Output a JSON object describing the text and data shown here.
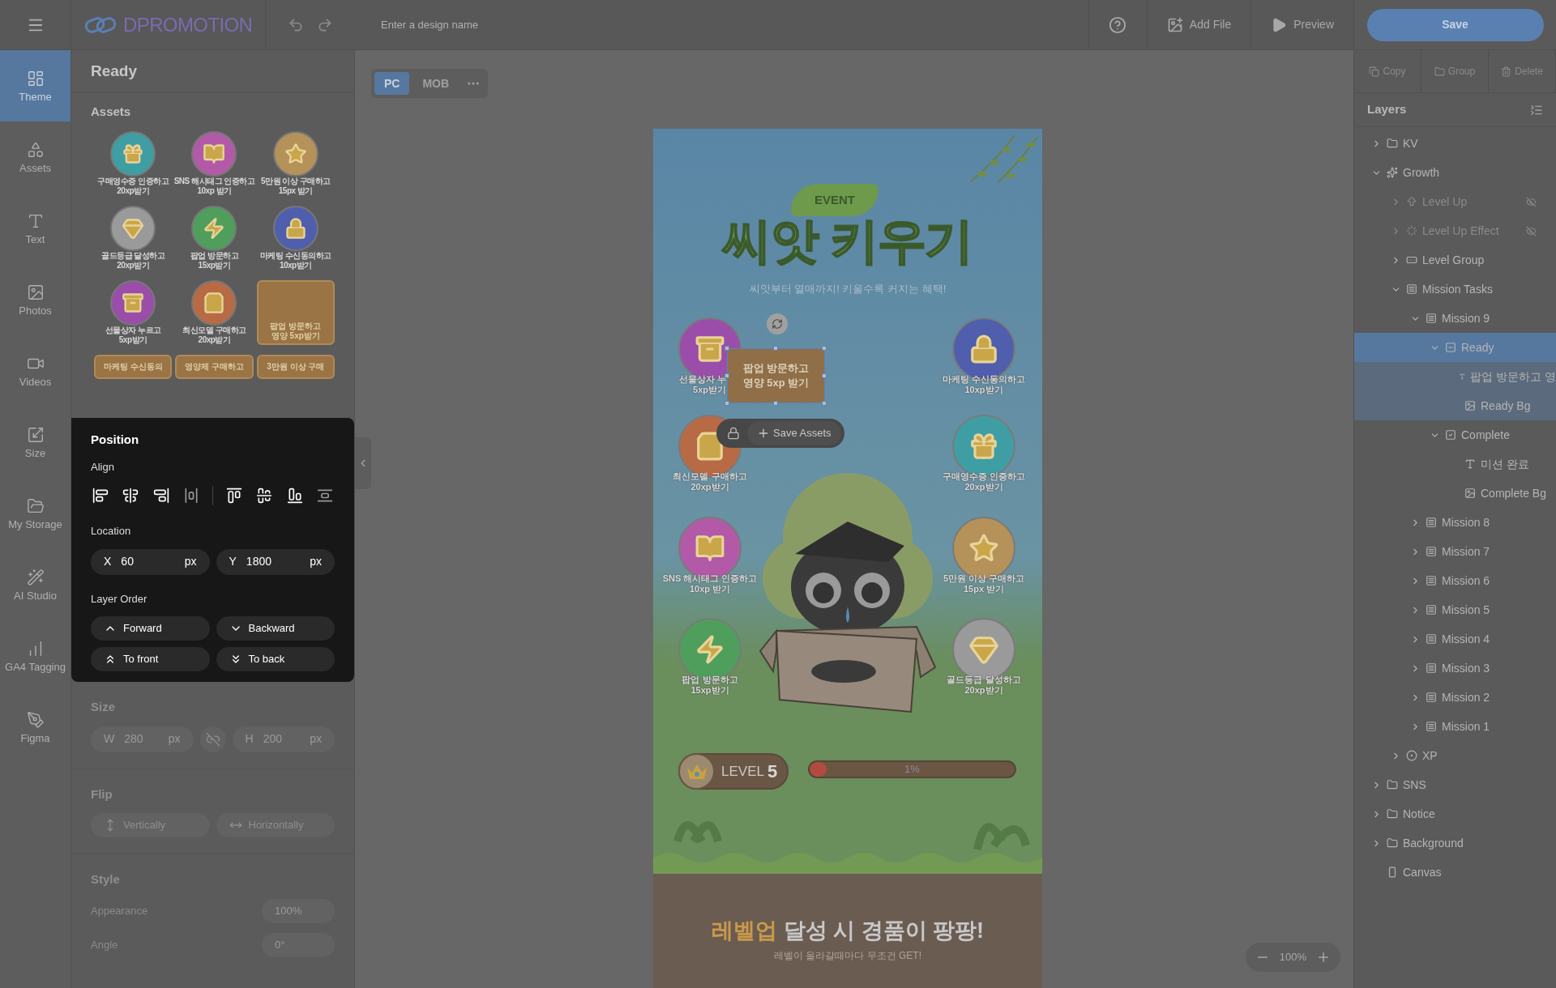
{
  "topbar": {
    "logo": "DPROMOTION",
    "design_name": {
      "placeholder": "Enter a design name"
    },
    "actions": [
      {
        "kind": "help"
      },
      {
        "kind": "addfile",
        "label": "Add File"
      },
      {
        "kind": "preview",
        "label": "Preview"
      }
    ],
    "save": "Save"
  },
  "rail": [
    {
      "label": "Theme",
      "selected": true
    },
    {
      "label": "Assets",
      "selected": false
    },
    {
      "label": "Text",
      "selected": false
    },
    {
      "label": "Photos",
      "selected": false
    },
    {
      "label": "Videos",
      "selected": false
    },
    {
      "label": "Size",
      "selected": false
    },
    {
      "label": "My Storage",
      "selected": false
    },
    {
      "label": "AI Studio",
      "selected": false
    },
    {
      "label": "GA4 Tagging",
      "selected": false
    },
    {
      "label": "Figma",
      "selected": false
    }
  ],
  "panel": {
    "title": "Ready",
    "assets_title": "Assets",
    "assets": [
      {
        "kind": "gift",
        "color": "#3f9ea4",
        "lines": [
          "구매영수증 인증하고",
          "20xp받기"
        ]
      },
      {
        "kind": "book",
        "color": "#b25aa8",
        "lines": [
          "SNS 해시태그 인증하고",
          "10xp 받기"
        ]
      },
      {
        "kind": "coin",
        "color": "#b4925a",
        "lines": [
          "5만원 이상 구매하고",
          "15px 받기"
        ]
      },
      {
        "kind": "gem",
        "color": "#9a9a9a",
        "lines": [
          "골드등급 달성하고",
          "20xp받기"
        ]
      },
      {
        "kind": "bolt",
        "color": "#4f9e5c",
        "lines": [
          "팝업 방문하고",
          "15xp받기"
        ]
      },
      {
        "kind": "lock",
        "color": "#4f5fae",
        "lines": [
          "마케팅 수신동의하고",
          "10xp받기"
        ]
      },
      {
        "kind": "chest",
        "color": "#9a4eaa",
        "lines": [
          "선물상자 누르고",
          "5xp받기"
        ]
      },
      {
        "kind": "bag",
        "color": "#b86a45",
        "lines": [
          "최신모델 구매하고",
          "20xp받기"
        ]
      },
      {
        "kind": "card",
        "color": "#9a7445",
        "lines": [
          "팝업 방문하고",
          "영양 5xp받기"
        ]
      },
      {
        "kind": "card",
        "color": "#9a7445",
        "lines": [
          "마케팅 수신동의"
        ]
      },
      {
        "kind": "card",
        "color": "#9a7445",
        "lines": [
          "영양제 구매하고"
        ]
      },
      {
        "kind": "card",
        "color": "#9a7445",
        "lines": [
          "3만원 이상 구매"
        ]
      }
    ],
    "position": {
      "title": "Position",
      "align_label": "Align",
      "location_label": "Location",
      "x": {
        "axis": "X",
        "value": "60",
        "unit": "px"
      },
      "y": {
        "axis": "Y",
        "value": "1800",
        "unit": "px"
      },
      "order_label": "Layer Order",
      "order_buttons": [
        {
          "kind": "up",
          "label": "Forward"
        },
        {
          "kind": "down",
          "label": "Backward"
        },
        {
          "kind": "top",
          "label": "To front"
        },
        {
          "kind": "bottom",
          "label": "To back"
        }
      ]
    },
    "size": {
      "disabled": true,
      "title": "Size",
      "w": {
        "axis": "W",
        "value": "280",
        "unit": "px"
      },
      "h": {
        "axis": "H",
        "value": "200",
        "unit": "px"
      }
    },
    "flip": {
      "disabled": true,
      "title": "Flip",
      "buttons": [
        {
          "kind": "vertical",
          "label": "Vertically"
        },
        {
          "kind": "horizontal",
          "label": "Horizontally"
        }
      ]
    },
    "style": {
      "disabled": true,
      "title": "Style",
      "rows": [
        {
          "label": "Appearance",
          "value": "100%"
        },
        {
          "label": "Angle",
          "value": "0°"
        }
      ]
    }
  },
  "canvas": {
    "devices": [
      {
        "label": "PC",
        "selected": true
      },
      {
        "label": "MOB",
        "selected": false
      }
    ],
    "zoom": "100%",
    "artboard": {
      "tag": "EVENT",
      "title": "씨앗 키우기",
      "subtitle": "씨앗부터 열매까지! 키울수록 커지는 혜택!",
      "missions": [
        {
          "kind": "chest",
          "color": "#9a4eaa",
          "lines": [
            "선물상자 누",
            "5xp받기"
          ]
        },
        {
          "kind": "lock",
          "color": "#4f5fae",
          "lines": [
            "마케팅 수신동의하고",
            "10xp받기"
          ]
        },
        {
          "kind": "bag",
          "color": "#b86a45",
          "lines": [
            "최신모델 구매하고",
            "20xp받기"
          ]
        },
        {
          "kind": "gift",
          "color": "#3f9ea4",
          "lines": [
            "구매영수증 인증하고",
            "20xp받기"
          ]
        },
        {
          "kind": "book",
          "color": "#b25aa8",
          "lines": [
            "SNS 해시태그 인증하고",
            "10xp 받기"
          ]
        },
        {
          "kind": "coin",
          "color": "#b4925a",
          "lines": [
            "5만원 이상 구매하고",
            "15px 받기"
          ]
        },
        {
          "kind": "bolt",
          "color": "#4f9e5c",
          "lines": [
            "팝업 방문하고",
            "15xp받기"
          ]
        },
        {
          "kind": "gem",
          "color": "#9a9a9a",
          "lines": [
            "골드등급 달성하고",
            "20xp받기"
          ]
        }
      ],
      "selected_card": {
        "lines": [
          "팝업 방문하고",
          "영양 5xp 받기"
        ]
      },
      "element_toolbar": {
        "save": "Save Assets"
      },
      "level": {
        "label": "LEVEL",
        "number": "5",
        "progress": {
          "level": 0.01,
          "reading": "1%"
        }
      },
      "headline": {
        "highlight": "레벨업",
        "rest": "달성 시 경품이 팡팡!"
      },
      "subline": "레벨이 올라갈때마다 무조건 GET!"
    }
  },
  "right": {
    "tools": [
      {
        "kind": "copy",
        "label": "Copy"
      },
      {
        "kind": "group",
        "label": "Group"
      },
      {
        "kind": "delete",
        "label": "Delete"
      }
    ],
    "layers_title": "Layers",
    "layers": [
      {
        "kind": "folder",
        "label": "KV",
        "expanded": false,
        "selected": false
      },
      {
        "kind": "sparkle",
        "label": "Growth",
        "expanded": true,
        "selected": false,
        "children": [
          {
            "kind": "arrow",
            "label": "Level Up",
            "expanded": false,
            "selected": false,
            "hidden": true
          },
          {
            "kind": "loader",
            "label": "Level Up Effect",
            "expanded": false,
            "selected": false,
            "hidden": true
          },
          {
            "kind": "badge",
            "label": "Level Group",
            "expanded": false,
            "selected": false
          },
          {
            "kind": "list",
            "label": "Mission Tasks",
            "expanded": true,
            "selected": false,
            "children": [
              {
                "kind": "list",
                "label": "Mission 9",
                "expanded": true,
                "selected": false,
                "children": [
                  {
                    "kind": "minus",
                    "label": "Ready",
                    "expanded": true,
                    "selected": true,
                    "children": [
                      {
                        "kind": "text",
                        "label": "팝업 방문하고 영",
                        "selected": false
                      },
                      {
                        "kind": "image",
                        "label": "Ready Bg",
                        "selected": false
                      }
                    ]
                  },
                  {
                    "kind": "check",
                    "label": "Complete",
                    "expanded": true,
                    "selected": false,
                    "children": [
                      {
                        "kind": "text",
                        "label": "미션 완료",
                        "selected": false
                      },
                      {
                        "kind": "image",
                        "label": "Complete Bg",
                        "selected": false
                      }
                    ]
                  }
                ]
              },
              {
                "kind": "list",
                "label": "Mission 8",
                "expanded": false,
                "selected": false
              },
              {
                "kind": "list",
                "label": "Mission 7",
                "expanded": false,
                "selected": false
              },
              {
                "kind": "list",
                "label": "Mission 6",
                "expanded": false,
                "selected": false
              },
              {
                "kind": "list",
                "label": "Mission 5",
                "expanded": false,
                "selected": false
              },
              {
                "kind": "list",
                "label": "Mission 4",
                "expanded": false,
                "selected": false
              },
              {
                "kind": "list",
                "label": "Mission 3",
                "expanded": false,
                "selected": false
              },
              {
                "kind": "list",
                "label": "Mission 2",
                "expanded": false,
                "selected": false
              },
              {
                "kind": "list",
                "label": "Mission 1",
                "expanded": false,
                "selected": false
              }
            ]
          },
          {
            "kind": "coin",
            "label": "XP",
            "expanded": false,
            "selected": false
          }
        ]
      },
      {
        "kind": "folder",
        "label": "SNS",
        "expanded": false,
        "selected": false
      },
      {
        "kind": "folder",
        "label": "Notice",
        "expanded": false,
        "selected": false
      },
      {
        "kind": "folder",
        "label": "Background",
        "expanded": false,
        "selected": false
      },
      {
        "kind": "canvas",
        "label": "Canvas",
        "selected": false
      }
    ]
  }
}
